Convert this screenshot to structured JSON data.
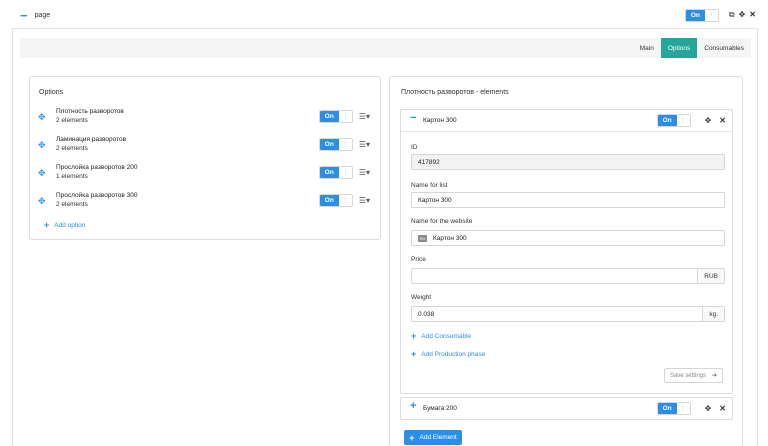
{
  "page": {
    "title": "page",
    "toggle_on": "On"
  },
  "tabs": [
    {
      "label": "Main"
    },
    {
      "label": "Options"
    },
    {
      "label": "Consumables"
    }
  ],
  "options_panel": {
    "title": "Options",
    "items": [
      {
        "name": "Плотность разворотов",
        "count": "2 elements",
        "toggle": "On"
      },
      {
        "name": "Ламинация разворотов",
        "count": "2 elements",
        "toggle": "On"
      },
      {
        "name": "Прослойка разворотов 200",
        "count": "1 elements",
        "toggle": "On"
      },
      {
        "name": "Прослойка разворотов 300",
        "count": "2 elements",
        "toggle": "On"
      }
    ],
    "add_option": "Add option"
  },
  "elements_panel": {
    "title": "Плотность разворотов - elements",
    "card1": {
      "name": "Картон 300",
      "toggle": "On",
      "fields": {
        "id_label": "ID",
        "id_value": "417892",
        "name_list_label": "Name for list",
        "name_list_value": "Картон 300",
        "name_site_label": "Name for the website",
        "name_site_value": "Картон 300",
        "price_label": "Price",
        "price_value": "",
        "price_unit": "RUB",
        "weight_label": "Weight",
        "weight_value": "0.038",
        "weight_unit": "kg."
      },
      "add_consumable": "Add Consumable",
      "add_production_phase": "Add Production phase",
      "save_settings": "Save settings"
    },
    "card2": {
      "name": "Бумага 200",
      "toggle": "On"
    },
    "add_element": "Add Element"
  },
  "colors": {
    "accent": "#2b8fe8",
    "active_tab": "#26a69a"
  }
}
